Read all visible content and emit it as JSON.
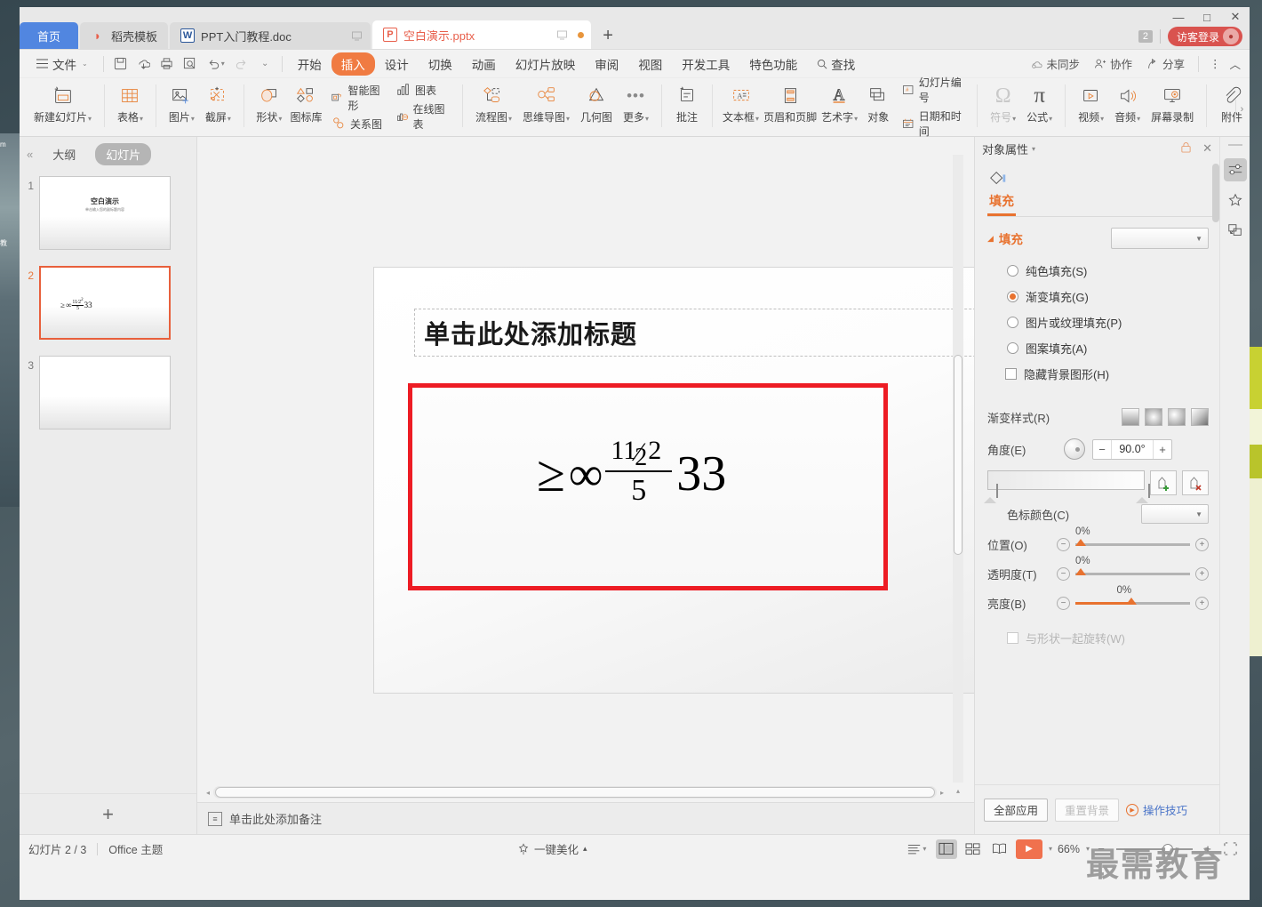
{
  "window": {
    "controls": {
      "minimize": "—",
      "maximize": "□",
      "close": "✕"
    }
  },
  "tabs": {
    "home_label": "首页",
    "items": [
      {
        "label": "稻壳模板",
        "icon": "docer-icon",
        "icon_glyph": "◗"
      },
      {
        "label": "PPT入门教程.doc",
        "icon": "word-doc-icon",
        "icon_glyph": "W"
      },
      {
        "label": "空白演示.pptx",
        "icon": "wps-presentation-icon",
        "icon_glyph": "P"
      }
    ],
    "new_tab": "+",
    "tab_count": "2",
    "guest_login": "访客登录"
  },
  "menu": {
    "file_label": "文件",
    "quick_access": [
      "save-icon",
      "cloud-sync-icon",
      "print-icon",
      "print-preview-icon",
      "undo-icon",
      "redo-icon",
      "customize-icon"
    ],
    "items": [
      "开始",
      "插入",
      "设计",
      "切换",
      "动画",
      "幻灯片放映",
      "审阅",
      "视图",
      "开发工具",
      "特色功能"
    ],
    "selected": "插入",
    "search_label": "查找",
    "right_items": [
      {
        "label": "未同步",
        "icon": "cloud-sync-icon"
      },
      {
        "label": "协作",
        "icon": "collaborate-icon"
      },
      {
        "label": "分享",
        "icon": "share-icon"
      }
    ],
    "more_icon": "⋮",
    "collapse_icon": "︿"
  },
  "ribbon": {
    "groups": [
      {
        "buttons": [
          {
            "label": "新建幻灯片",
            "icon": "new-slide-icon",
            "has_dropdown": true
          }
        ]
      },
      {
        "buttons": [
          {
            "label": "表格",
            "icon": "table-icon",
            "has_dropdown": true
          }
        ]
      },
      {
        "buttons": [
          {
            "label": "图片",
            "icon": "picture-icon",
            "has_dropdown": true
          },
          {
            "label": "截屏",
            "icon": "screenshot-icon",
            "has_dropdown": true
          }
        ]
      },
      {
        "buttons": [
          {
            "label": "形状",
            "icon": "shapes-icon",
            "has_dropdown": true
          },
          {
            "label": "图标库",
            "icon": "icon-library-icon",
            "has_dropdown": false
          }
        ],
        "stacks": [
          {
            "label": "智能图形",
            "icon": "smartart-icon"
          },
          {
            "label": "关系图",
            "icon": "relation-chart-icon"
          }
        ],
        "stacks2": [
          {
            "label": "图表",
            "icon": "chart-icon"
          },
          {
            "label": "在线图表",
            "icon": "online-chart-icon"
          }
        ]
      },
      {
        "buttons": [
          {
            "label": "流程图",
            "icon": "flowchart-icon",
            "has_dropdown": true
          },
          {
            "label": "思维导图",
            "icon": "mindmap-icon",
            "has_dropdown": true
          },
          {
            "label": "几何图",
            "icon": "geometry-icon",
            "has_dropdown": false
          },
          {
            "label": "更多",
            "icon": "more-dots-icon",
            "has_dropdown": true
          }
        ]
      },
      {
        "buttons": [
          {
            "label": "批注",
            "icon": "comment-icon",
            "has_dropdown": false
          }
        ]
      },
      {
        "buttons": [
          {
            "label": "文本框",
            "icon": "textbox-icon",
            "has_dropdown": true
          },
          {
            "label": "页眉和页脚",
            "icon": "header-footer-icon",
            "has_dropdown": false
          },
          {
            "label": "艺术字",
            "icon": "wordart-icon",
            "has_dropdown": true
          },
          {
            "label": "对象",
            "icon": "object-icon",
            "has_dropdown": false
          }
        ],
        "stacks": [
          {
            "label": "幻灯片编号",
            "icon": "slide-number-icon"
          },
          {
            "label": "日期和时间",
            "icon": "date-time-icon"
          }
        ]
      },
      {
        "buttons": [
          {
            "label": "符号",
            "icon": "symbol-icon",
            "has_dropdown": true,
            "disabled": true
          },
          {
            "label": "公式",
            "icon": "formula-icon",
            "has_dropdown": true
          }
        ]
      },
      {
        "buttons": [
          {
            "label": "视频",
            "icon": "video-icon",
            "has_dropdown": true
          },
          {
            "label": "音频",
            "icon": "audio-icon",
            "has_dropdown": true
          },
          {
            "label": "屏幕录制",
            "icon": "screen-record-icon",
            "has_dropdown": false
          }
        ]
      },
      {
        "buttons": [
          {
            "label": "附件",
            "icon": "attachment-icon",
            "has_dropdown": false
          }
        ]
      }
    ]
  },
  "slide_panel": {
    "collapse_icon": "«",
    "tab_outline": "大纲",
    "tab_slides": "幻灯片",
    "selected_tab": "幻灯片",
    "add_slide": "+",
    "slides": [
      {
        "number": "1",
        "title": "空白演示",
        "subtitle": "单击输入您的副标题内容",
        "selected": false
      },
      {
        "number": "2",
        "formula": "≥∞ 11/2 2 / 5 33",
        "selected": true
      },
      {
        "number": "3",
        "selected": false
      }
    ]
  },
  "slide": {
    "title_placeholder": "单击此处添加标题",
    "formula": {
      "ge": "≥",
      "infinity": "∞",
      "numerator_a": "11",
      "slash": "⁄",
      "numerator_b": "2",
      "numerator_c": "2",
      "denominator": "5",
      "trailing": "33"
    }
  },
  "notes": {
    "placeholder": "单击此处添加备注",
    "icon": "notes-icon"
  },
  "right_panel": {
    "title": "对象属性",
    "dropdown_icon": "▾",
    "lock_icon": "lock-icon",
    "close_icon": "✕",
    "tab_icon": "fill-icon",
    "tab_label": "填充",
    "section_title": "填充",
    "fill_options": [
      {
        "label": "纯色填充(S)",
        "selected": false
      },
      {
        "label": "渐变填充(G)",
        "selected": true
      },
      {
        "label": "图片或纹理填充(P)",
        "selected": false
      },
      {
        "label": "图案填充(A)",
        "selected": false
      }
    ],
    "hide_bg_graphic": "隐藏背景图形(H)",
    "gradient_style_label": "渐变样式(R)",
    "angle_label": "角度(E)",
    "angle_value": "90.0°",
    "minus": "−",
    "plus": "+",
    "stop_color_label": "色标颜色(C)",
    "sliders": [
      {
        "label": "位置(O)",
        "value": "0%",
        "pos_pct": 2,
        "fill": false
      },
      {
        "label": "透明度(T)",
        "value": "0%",
        "pos_pct": 2,
        "fill": false
      },
      {
        "label": "亮度(B)",
        "value": "0%",
        "pos_pct": 50,
        "fill": true
      }
    ],
    "rotate_with_shape": "与形状一起旋转(W)",
    "apply_all": "全部应用",
    "reset_bg": "重置背景",
    "tips": "操作技巧"
  },
  "rail": {
    "items": [
      {
        "icon": "properties-sliders-icon",
        "active": true
      },
      {
        "icon": "effects-star-icon",
        "active": false
      },
      {
        "icon": "select-pane-icon",
        "active": false
      }
    ],
    "bottom_icon": "apps-grid-icon"
  },
  "status_bar": {
    "slide_count": "幻灯片 2 / 3",
    "theme": "Office 主题",
    "beautify": "一键美化",
    "beautify_icon": "magic-wand-icon",
    "beautify_caret": "▴",
    "view_buttons": [
      {
        "icon": "outline-view-icon",
        "active": false,
        "has_caret": true
      },
      {
        "icon": "normal-view-icon",
        "active": true
      },
      {
        "icon": "slide-sorter-icon",
        "active": false
      },
      {
        "icon": "reading-view-icon",
        "active": false
      }
    ],
    "play_icon": "▶",
    "play_caret": "▾",
    "zoom_level": "66%",
    "zoom_caret": "▾",
    "zoom_minus": "−",
    "zoom_plus": "+",
    "fit_icon": "fit-slide-icon"
  },
  "watermark": "最需教育",
  "colors": {
    "accent_orange": "#e8722f",
    "selected_tab_orange": "#f07b42",
    "home_blue": "#5186e0",
    "formula_border_red": "#ed1c24",
    "login_red": "#d9534f",
    "link_blue": "#4a74c8"
  }
}
